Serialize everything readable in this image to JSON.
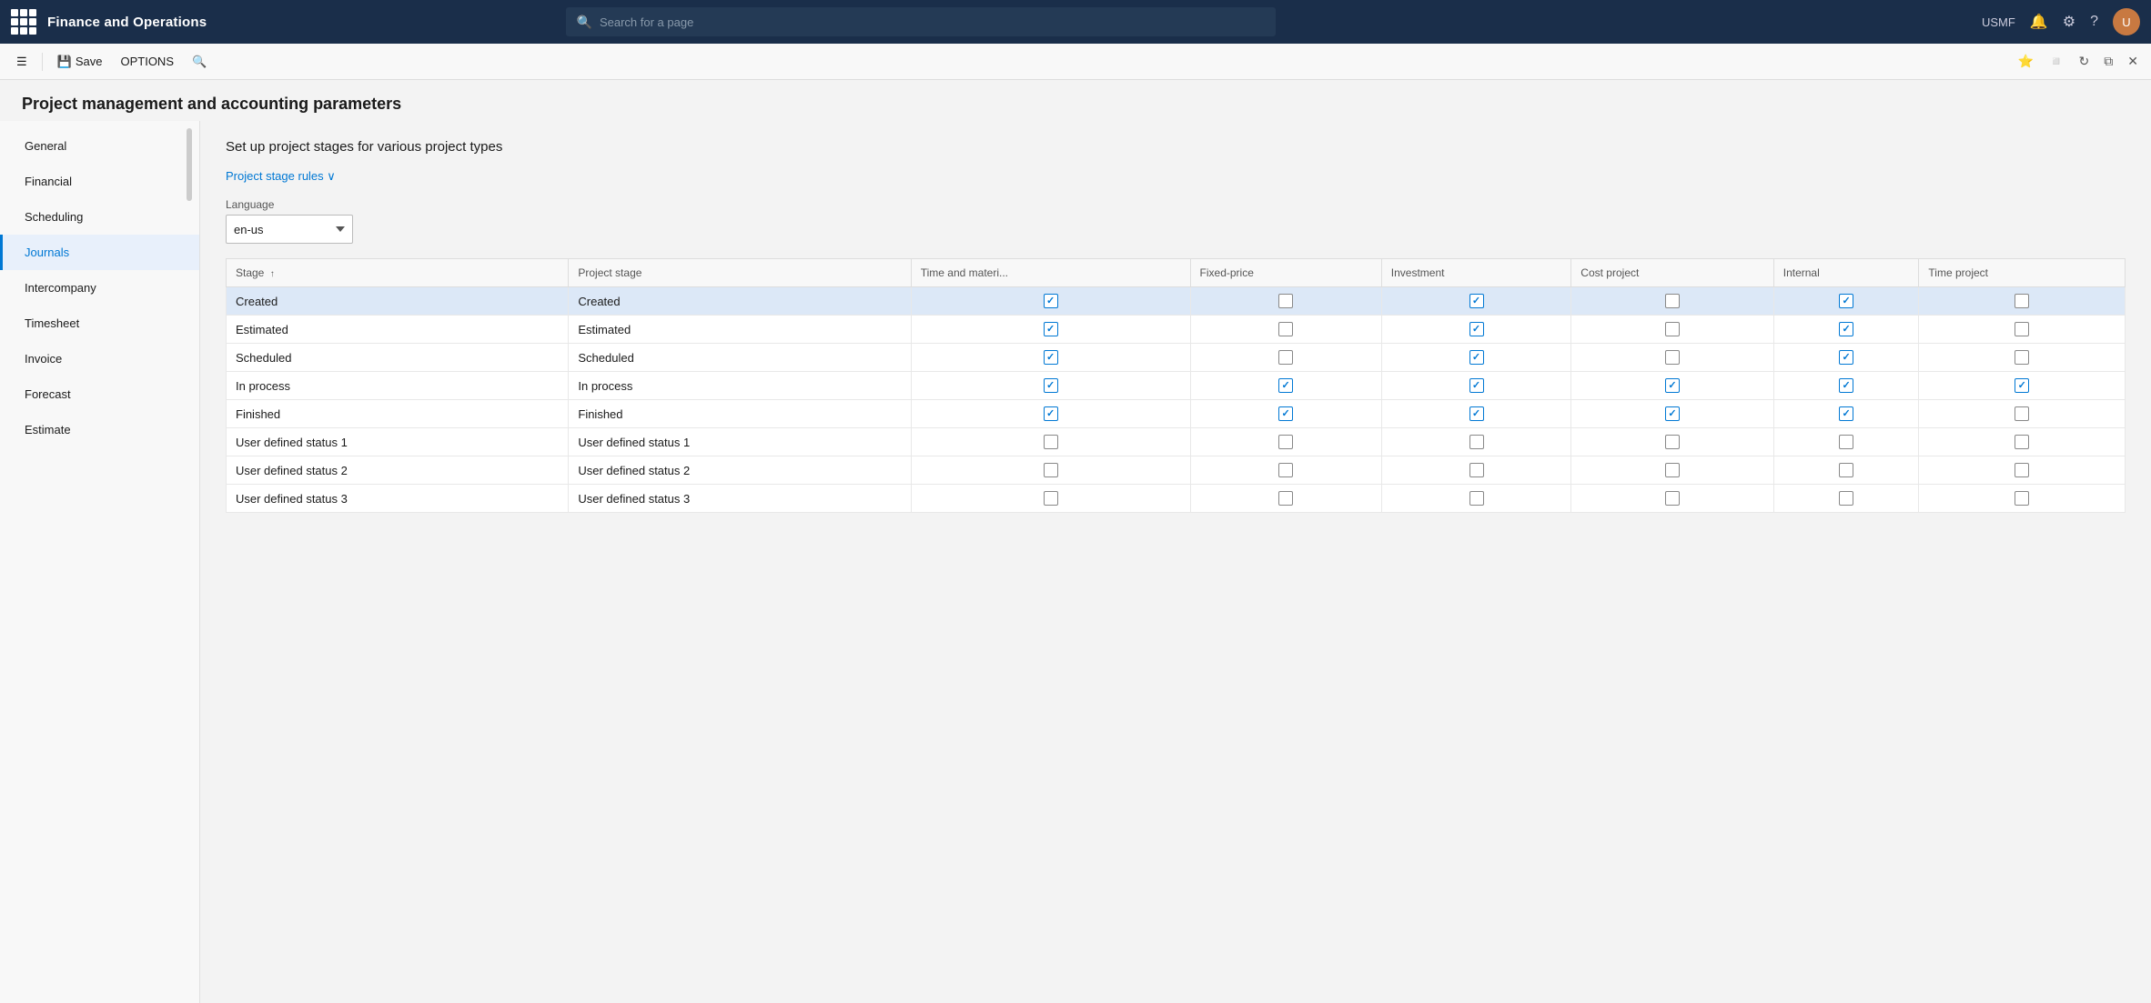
{
  "appTitle": "Finance and Operations",
  "search": {
    "placeholder": "Search for a page"
  },
  "nav": {
    "userCompany": "USMF",
    "avatarInitial": "U"
  },
  "toolbar": {
    "saveLabel": "Save",
    "optionsLabel": "OPTIONS"
  },
  "page": {
    "title": "Project management and accounting parameters",
    "sectionTitle": "Set up project stages for various project types",
    "expandLink": "Project stage rules ∨",
    "languageLabel": "Language",
    "languageValue": "en-us"
  },
  "sidebar": {
    "items": [
      {
        "id": "general",
        "label": "General"
      },
      {
        "id": "financial",
        "label": "Financial"
      },
      {
        "id": "scheduling",
        "label": "Scheduling"
      },
      {
        "id": "journals",
        "label": "Journals"
      },
      {
        "id": "intercompany",
        "label": "Intercompany"
      },
      {
        "id": "timesheet",
        "label": "Timesheet"
      },
      {
        "id": "invoice",
        "label": "Invoice"
      },
      {
        "id": "forecast",
        "label": "Forecast"
      },
      {
        "id": "estimate",
        "label": "Estimate"
      }
    ],
    "activeItem": "journals"
  },
  "table": {
    "columns": [
      {
        "id": "stage",
        "label": "Stage",
        "sortable": true
      },
      {
        "id": "project_stage",
        "label": "Project stage"
      },
      {
        "id": "time_material",
        "label": "Time and materi..."
      },
      {
        "id": "fixed_price",
        "label": "Fixed-price"
      },
      {
        "id": "investment",
        "label": "Investment"
      },
      {
        "id": "cost_project",
        "label": "Cost project"
      },
      {
        "id": "internal",
        "label": "Internal"
      },
      {
        "id": "time_project",
        "label": "Time project"
      }
    ],
    "rows": [
      {
        "id": "created",
        "stage": "Created",
        "projectStage": "Created",
        "timeMaterial": true,
        "fixedPrice": false,
        "investment": true,
        "costProject": false,
        "internal": true,
        "timeProject": false,
        "selected": true
      },
      {
        "id": "estimated",
        "stage": "Estimated",
        "projectStage": "Estimated",
        "timeMaterial": true,
        "fixedPrice": false,
        "investment": true,
        "costProject": false,
        "internal": true,
        "timeProject": false,
        "selected": false
      },
      {
        "id": "scheduled",
        "stage": "Scheduled",
        "projectStage": "Scheduled",
        "timeMaterial": true,
        "fixedPrice": false,
        "investment": true,
        "costProject": false,
        "internal": true,
        "timeProject": false,
        "selected": false
      },
      {
        "id": "in_process",
        "stage": "In process",
        "projectStage": "In process",
        "timeMaterial": true,
        "fixedPrice": true,
        "investment": true,
        "costProject": true,
        "internal": true,
        "timeProject": true,
        "selected": false
      },
      {
        "id": "finished",
        "stage": "Finished",
        "projectStage": "Finished",
        "timeMaterial": true,
        "fixedPrice": true,
        "investment": true,
        "costProject": true,
        "internal": true,
        "timeProject": false,
        "selected": false
      },
      {
        "id": "user_status_1",
        "stage": "User defined status 1",
        "projectStage": "User defined status 1",
        "timeMaterial": false,
        "fixedPrice": false,
        "investment": false,
        "costProject": false,
        "internal": false,
        "timeProject": false,
        "selected": false
      },
      {
        "id": "user_status_2",
        "stage": "User defined status 2",
        "projectStage": "User defined status 2",
        "timeMaterial": false,
        "fixedPrice": false,
        "investment": false,
        "costProject": false,
        "internal": false,
        "timeProject": false,
        "selected": false
      },
      {
        "id": "user_status_3",
        "stage": "User defined status 3",
        "projectStage": "User defined status 3",
        "timeMaterial": false,
        "fixedPrice": false,
        "investment": false,
        "costProject": false,
        "internal": false,
        "timeProject": false,
        "selected": false
      }
    ]
  }
}
